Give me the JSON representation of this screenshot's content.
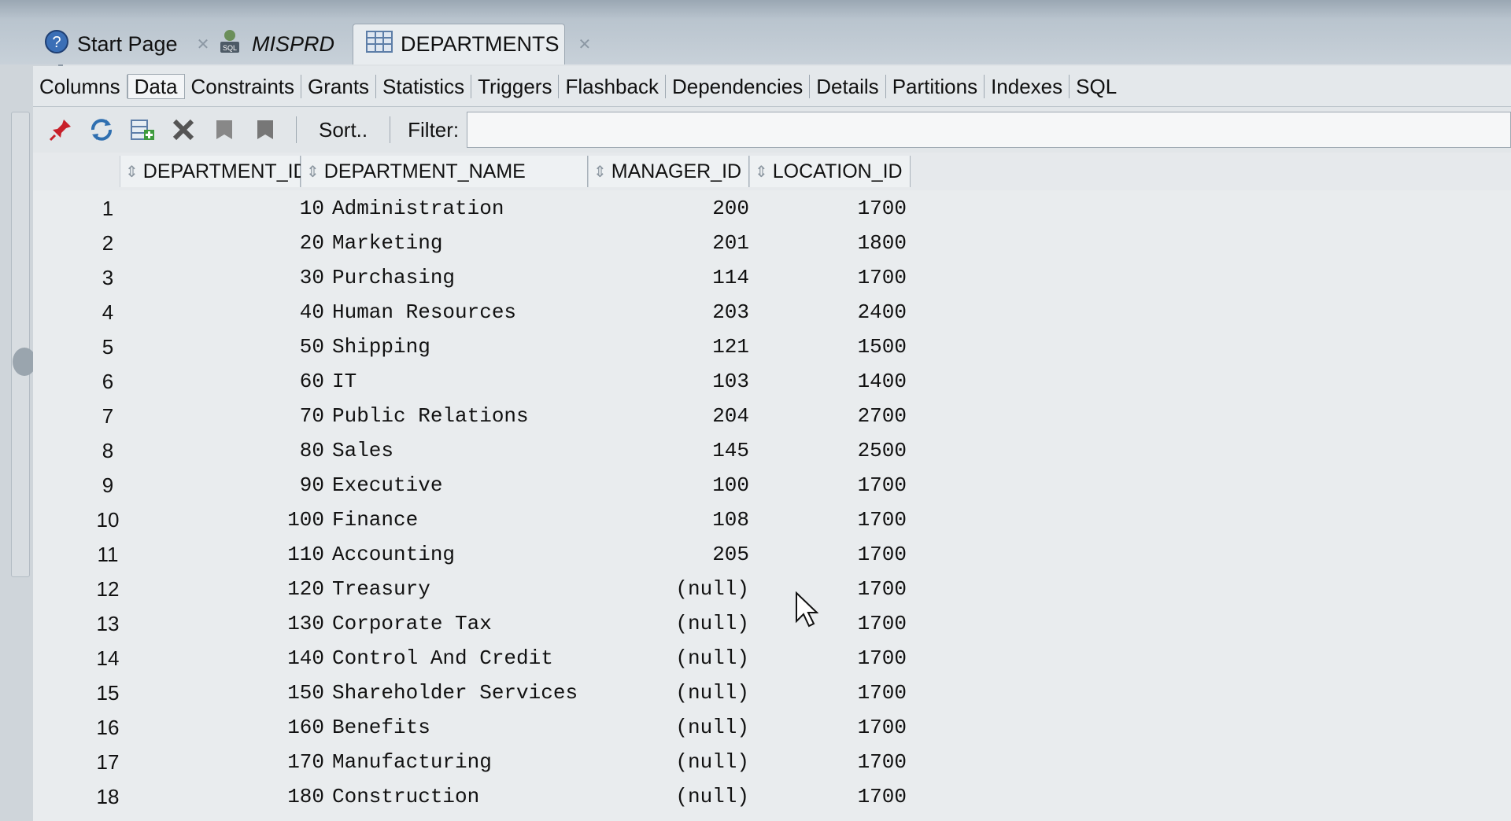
{
  "tabs": [
    {
      "label": "Start Page",
      "icon": "help-icon"
    },
    {
      "label": "MISPRD",
      "icon": "sql-connection-icon"
    },
    {
      "label": "DEPARTMENTS",
      "icon": "table-grid-icon"
    }
  ],
  "subtabs": [
    "Columns",
    "Data",
    "Constraints",
    "Grants",
    "Statistics",
    "Triggers",
    "Flashback",
    "Dependencies",
    "Details",
    "Partitions",
    "Indexes",
    "SQL"
  ],
  "active_subtab": "Data",
  "toolbar": {
    "sort_label": "Sort..",
    "filter_label": "Filter:",
    "filter_value": ""
  },
  "columns": [
    "DEPARTMENT_ID",
    "DEPARTMENT_NAME",
    "MANAGER_ID",
    "LOCATION_ID"
  ],
  "rows": [
    {
      "n": "1",
      "id": "10",
      "name": "Administration",
      "mgr": "200",
      "loc": "1700"
    },
    {
      "n": "2",
      "id": "20",
      "name": "Marketing",
      "mgr": "201",
      "loc": "1800"
    },
    {
      "n": "3",
      "id": "30",
      "name": "Purchasing",
      "mgr": "114",
      "loc": "1700"
    },
    {
      "n": "4",
      "id": "40",
      "name": "Human Resources",
      "mgr": "203",
      "loc": "2400"
    },
    {
      "n": "5",
      "id": "50",
      "name": "Shipping",
      "mgr": "121",
      "loc": "1500"
    },
    {
      "n": "6",
      "id": "60",
      "name": "IT",
      "mgr": "103",
      "loc": "1400"
    },
    {
      "n": "7",
      "id": "70",
      "name": "Public Relations",
      "mgr": "204",
      "loc": "2700"
    },
    {
      "n": "8",
      "id": "80",
      "name": "Sales",
      "mgr": "145",
      "loc": "2500"
    },
    {
      "n": "9",
      "id": "90",
      "name": "Executive",
      "mgr": "100",
      "loc": "1700"
    },
    {
      "n": "10",
      "id": "100",
      "name": "Finance",
      "mgr": "108",
      "loc": "1700"
    },
    {
      "n": "11",
      "id": "110",
      "name": "Accounting",
      "mgr": "205",
      "loc": "1700"
    },
    {
      "n": "12",
      "id": "120",
      "name": "Treasury",
      "mgr": "(null)",
      "loc": "1700"
    },
    {
      "n": "13",
      "id": "130",
      "name": "Corporate Tax",
      "mgr": "(null)",
      "loc": "1700"
    },
    {
      "n": "14",
      "id": "140",
      "name": "Control And Credit",
      "mgr": "(null)",
      "loc": "1700"
    },
    {
      "n": "15",
      "id": "150",
      "name": "Shareholder Services",
      "mgr": "(null)",
      "loc": "1700"
    },
    {
      "n": "16",
      "id": "160",
      "name": "Benefits",
      "mgr": "(null)",
      "loc": "1700"
    },
    {
      "n": "17",
      "id": "170",
      "name": "Manufacturing",
      "mgr": "(null)",
      "loc": "1700"
    },
    {
      "n": "18",
      "id": "180",
      "name": "Construction",
      "mgr": "(null)",
      "loc": "1700"
    }
  ]
}
